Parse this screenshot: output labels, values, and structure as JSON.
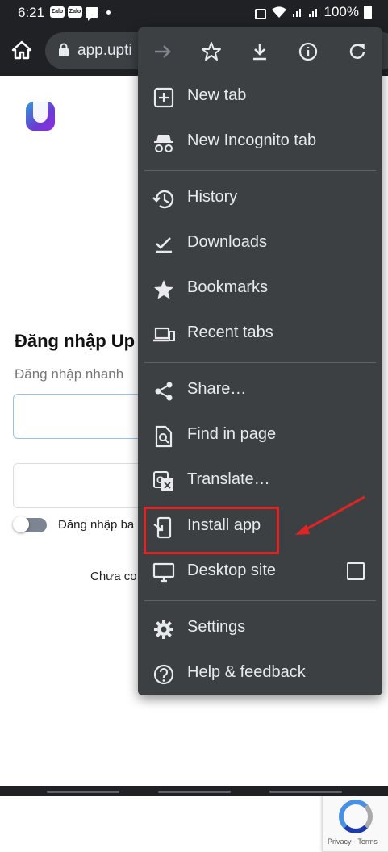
{
  "status_bar": {
    "time": "6:21",
    "zalo_label": "Zalo",
    "battery_percent": "100%"
  },
  "toolbar": {
    "url": "app.upti"
  },
  "page": {
    "login_title": "Đăng nhập Up",
    "login_subtitle": "Đăng nhập nhanh",
    "remember_label": "Đăng nhập ba",
    "signup_text": "Chưa co",
    "recaptcha_text": "Privacy - Terms"
  },
  "menu": {
    "top_icons": [
      "forward-icon",
      "star-icon",
      "download-icon",
      "info-icon",
      "refresh-icon"
    ],
    "items": [
      {
        "label": "New tab",
        "icon": "new-tab-icon"
      },
      {
        "label": "New Incognito tab",
        "icon": "incognito-icon"
      },
      {
        "label": "History",
        "icon": "history-icon"
      },
      {
        "label": "Downloads",
        "icon": "downloads-icon"
      },
      {
        "label": "Bookmarks",
        "icon": "bookmarks-icon"
      },
      {
        "label": "Recent tabs",
        "icon": "recent-tabs-icon"
      },
      {
        "label": "Share…",
        "icon": "share-icon"
      },
      {
        "label": "Find in page",
        "icon": "find-in-page-icon"
      },
      {
        "label": "Translate…",
        "icon": "translate-icon"
      },
      {
        "label": "Install app",
        "icon": "install-app-icon"
      },
      {
        "label": "Desktop site",
        "icon": "desktop-icon"
      },
      {
        "label": "Settings",
        "icon": "settings-icon"
      },
      {
        "label": "Help & feedback",
        "icon": "help-icon"
      }
    ]
  },
  "colors": {
    "menu_bg": "#3c4043",
    "toolbar_bg": "#202124",
    "highlight": "#e02424"
  }
}
